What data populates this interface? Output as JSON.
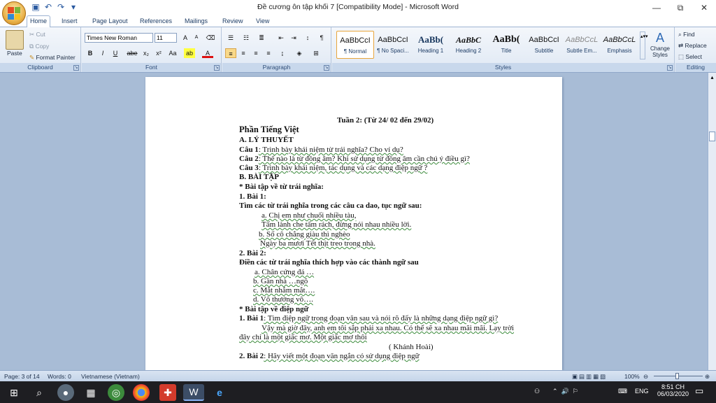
{
  "window": {
    "title": "Đề cương ôn tập khối 7 [Compatibility Mode] - Microsoft Word",
    "controls": [
      "—",
      "⧉",
      "✕"
    ]
  },
  "qat": {
    "icons": [
      "save-icon",
      "undo-icon",
      "redo-icon"
    ],
    "customize": "▾"
  },
  "tabs": [
    "Home",
    "Insert",
    "Page Layout",
    "References",
    "Mailings",
    "Review",
    "View"
  ],
  "ribbon": {
    "clipboard": {
      "paste": "Paste",
      "cut": "Cut",
      "copy": "Copy",
      "format_painter": "Format Painter",
      "label": "Clipboard"
    },
    "font": {
      "family": "Times New Roman",
      "size": "11",
      "label": "Font",
      "bold": "B",
      "italic": "I",
      "underline": "U",
      "strike": "abe",
      "subscript": "x₂",
      "superscript": "x²",
      "change_case": "Aa",
      "grow": "A",
      "shrink": "A"
    },
    "paragraph": {
      "label": "Paragraph"
    },
    "styles": {
      "label": "Styles",
      "items": [
        {
          "preview": "AaBbCcI",
          "name": "¶ Normal"
        },
        {
          "preview": "AaBbCcI",
          "name": "¶ No Spaci..."
        },
        {
          "preview": "AaBb(",
          "name": "Heading 1"
        },
        {
          "preview": "AaBbC",
          "name": "Heading 2"
        },
        {
          "preview": "AaBb(",
          "name": "Title"
        },
        {
          "preview": "AaBbCcI",
          "name": "Subtitle"
        },
        {
          "preview": "AaBbCcL",
          "name": "Subtle Em..."
        },
        {
          "preview": "AaBbCcL",
          "name": "Emphasis"
        }
      ],
      "change_styles": "Change Styles"
    },
    "editing": {
      "find": "Find",
      "replace": "Replace",
      "select": "Select",
      "label": "Editing"
    }
  },
  "document": {
    "line1": "Tuần 2: (Từ 24/ 02 đến 29/02)",
    "line2": "Phần Tiếng Việt",
    "line3": "A. LÝ THUYẾT",
    "q1_label": "Câu 1",
    "q1_text": ": Trình bày khái niệm từ trái nghĩa? Cho ví dụ?",
    "q2_label": "Câu 2",
    "q2_text": ": Thế nào là từ đồng âm? Khi sử dụng từ đồng âm cần chú ý điều gì?",
    "q3_label": "Câu 3",
    "q3_text": ": Trình bày khái niệm, tác dụng và các dạng điệp ngữ ?",
    "line7": "B. BÀI TẬP",
    "line8": "* Bài tập về từ trái nghĩa:",
    "line9": "1. Bài 1:",
    "line10": "Tìm các từ trái nghĩa trong các câu ca dao, tục ngữ sau:",
    "line11": "a. Chị em như chuối nhiều tàu,",
    "line12": "Tấm lành che tấm rách, đừng nói nhau nhiều lời.",
    "line13": "b. Số cô chẳng giàu thì nghèo",
    "line14": "Ngày ba mươi Tết thịt treo trong nhà.",
    "line15": "2. Bài 2:",
    "line16": "Điền các từ trái nghĩa thích hợp vào các thành ngữ sau",
    "line17": "a. Chân cứng đá …",
    "line18": "b. Gần nhà …ngõ",
    "line19": "c. Mắt nhắm mắt….",
    "line20": "d. Vô thưởng vô….",
    "line21": "* Bài tập về điệp ngữ",
    "line22_label": "1. Bài 1",
    "line22_text": ": Tìm điệp ngữ trong đoạn văn sau và nói rõ đấy là những dạng điệp ngữ gì?",
    "line23": "Vậy mà giờ đây, anh em tôi sắp phải xa nhau. Có thể sẽ xa nhau mãi mãi. Lạy trời",
    "line24": "đây chỉ là một giấc mơ. Một giấc mơ thôi",
    "line25": "( Khánh Hoài)",
    "line26_label": "2. Bài 2",
    "line26_text": ": Hãy viết một đoạn văn ngắn có sử dụng điệp ngữ"
  },
  "status": {
    "page": "Page: 3 of 14",
    "words": "Words: 0",
    "language": "Vietnamese (Vietnam)",
    "zoom": "100%"
  },
  "taskbar": {
    "apps": [
      "windows-start-icon",
      "search-icon",
      "app-icon",
      "app-icon",
      "chrome-icon",
      "app-icon",
      "word-icon",
      "ie-icon"
    ],
    "lang": "ENG",
    "time": "8:51 CH",
    "date": "06/03/2020"
  }
}
